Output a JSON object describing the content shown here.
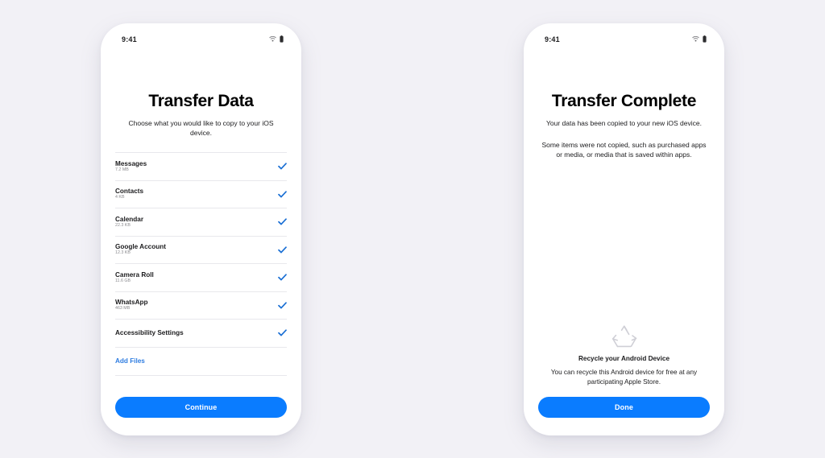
{
  "theme": {
    "background": "#f2f1f6",
    "card": "#ffffff",
    "accent_blue": "#0a7cff",
    "link_blue": "#2f7de1",
    "check_blue": "#1a6fd4",
    "text": "#1c1c1e",
    "muted": "#8a8a8e",
    "divider": "#e8e8ec"
  },
  "left_phone": {
    "status": {
      "time": "9:41",
      "wifi_icon": "wifi-icon",
      "battery_icon": "battery-icon"
    },
    "title": "Transfer Data",
    "subtitle": "Choose what you would like to copy to your iOS device.",
    "items": [
      {
        "label": "Messages",
        "size": "7.2 MB",
        "checked": true,
        "check_icon": "check-icon"
      },
      {
        "label": "Contacts",
        "size": "4 KB",
        "checked": true,
        "check_icon": "check-icon"
      },
      {
        "label": "Calendar",
        "size": "22.3 KB",
        "checked": true,
        "check_icon": "check-icon"
      },
      {
        "label": "Google Account",
        "size": "12.3 KB",
        "checked": true,
        "check_icon": "check-icon"
      },
      {
        "label": "Camera Roll",
        "size": "11.6 GB",
        "checked": true,
        "check_icon": "check-icon"
      },
      {
        "label": "WhatsApp",
        "size": "463 MB",
        "checked": true,
        "check_icon": "check-icon"
      },
      {
        "label": "Accessibility Settings",
        "size": "",
        "checked": true,
        "check_icon": "check-icon"
      }
    ],
    "add_files_label": "Add Files",
    "primary_button": "Continue"
  },
  "right_phone": {
    "status": {
      "time": "9:41",
      "wifi_icon": "wifi-icon",
      "battery_icon": "battery-icon"
    },
    "title": "Transfer Complete",
    "subtitle": "Your data has been copied to your new iOS device.",
    "note": "Some items were not copied, such as purchased apps or media, or media that is saved within apps.",
    "recycle": {
      "icon": "recycle-icon",
      "title": "Recycle your Android Device",
      "text": "You can recycle this Android device for free at any participating Apple Store."
    },
    "primary_button": "Done"
  }
}
